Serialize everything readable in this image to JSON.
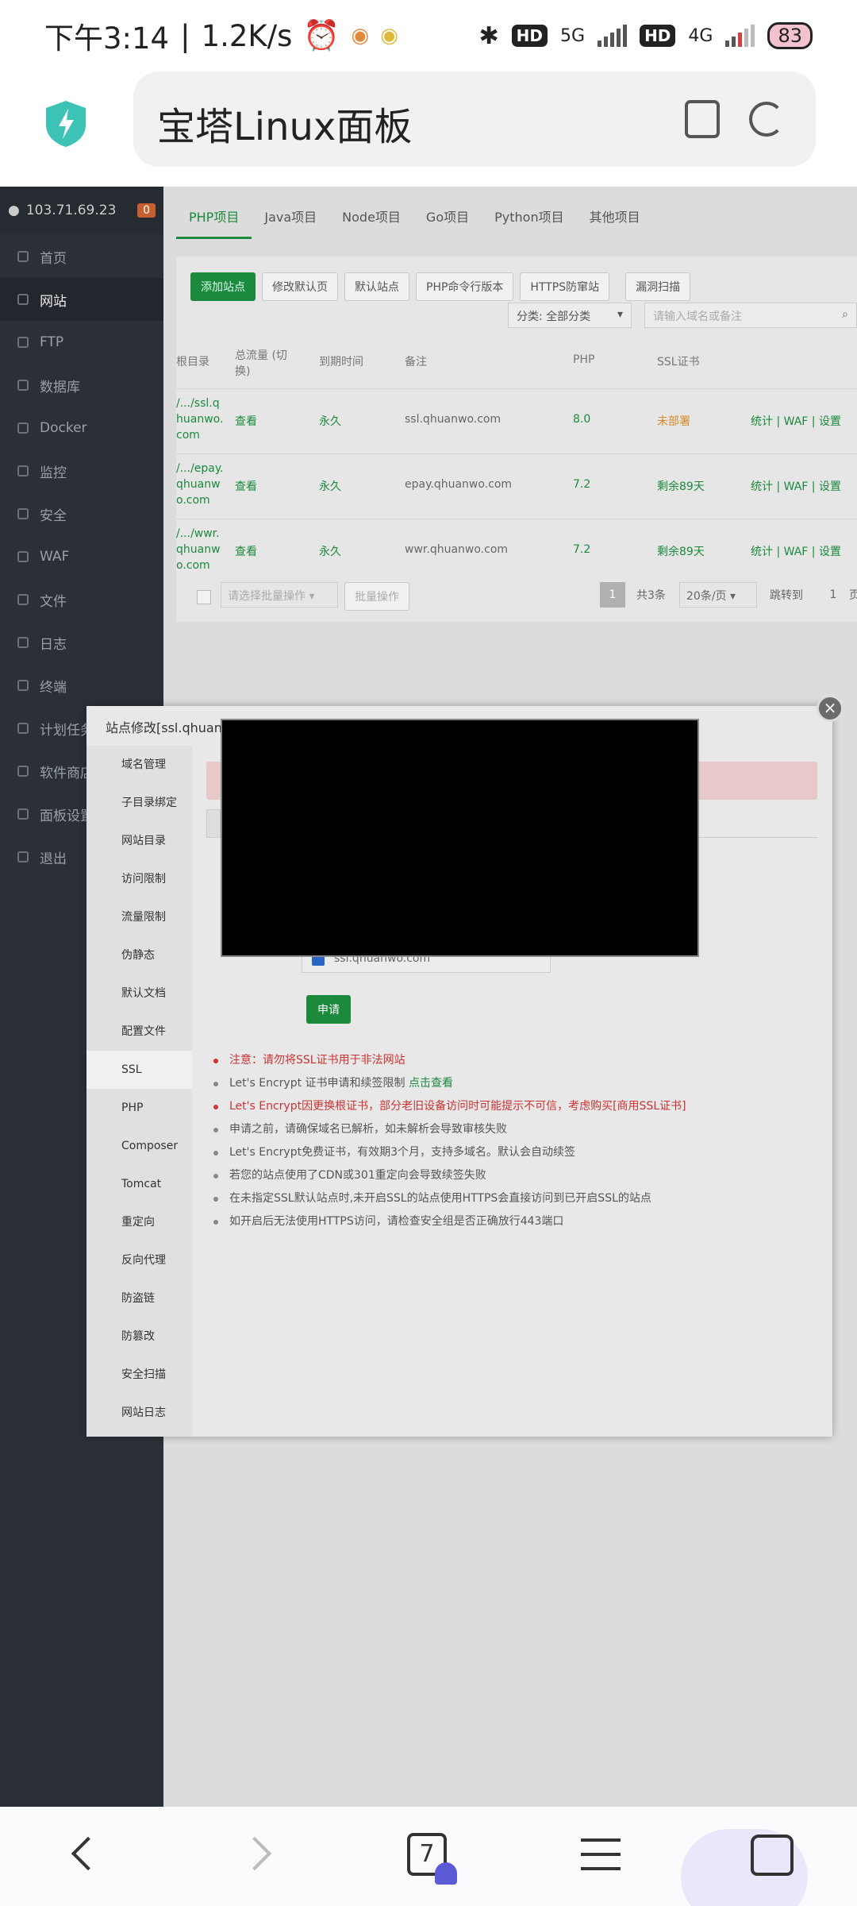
{
  "status_bar": {
    "time": "下午3:14",
    "speed": "1.2K/s",
    "hd1": "HD",
    "net1": "5G",
    "hd2": "HD",
    "net2": "4G",
    "battery": "83"
  },
  "browser": {
    "title": "宝塔Linux面板",
    "tab_count": "7"
  },
  "sidebar": {
    "ip": "103.71.69.23",
    "badge": "0",
    "items": [
      {
        "label": "首页"
      },
      {
        "label": "网站"
      },
      {
        "label": "FTP"
      },
      {
        "label": "数据库"
      },
      {
        "label": "Docker"
      },
      {
        "label": "监控"
      },
      {
        "label": "安全"
      },
      {
        "label": "WAF"
      },
      {
        "label": "文件"
      },
      {
        "label": "日志"
      },
      {
        "label": "终端"
      },
      {
        "label": "计划任务"
      },
      {
        "label": "软件商店"
      },
      {
        "label": "面板设置"
      },
      {
        "label": "退出"
      }
    ]
  },
  "tabs": [
    "PHP项目",
    "Java项目",
    "Node项目",
    "Go项目",
    "Python项目",
    "其他项目"
  ],
  "toolbar": {
    "add_site": "添加站点",
    "edit_default": "修改默认页",
    "default_site": "默认站点",
    "php_cli": "PHP命令行版本",
    "https_guard": "HTTPS防窜站",
    "vuln_scan": "漏洞扫描",
    "category": "分类: 全部分类",
    "search_placeholder": "请输入域名或备注"
  },
  "table": {
    "headers": [
      "根目录",
      "总流量 (切换)",
      "到期时间",
      "备注",
      "PHP",
      "SSL证书"
    ],
    "rows": [
      {
        "root": "/.../ssl.qhuanwo.com",
        "traffic": "查看",
        "expire": "永久",
        "note": "ssl.qhuanwo.com",
        "php": "8.0",
        "ssl": "未部署",
        "actions": "统计 | WAF | 设置"
      },
      {
        "root": "/.../epay.qhuanwo.com",
        "traffic": "查看",
        "expire": "永久",
        "note": "epay.qhuanwo.com",
        "php": "7.2",
        "ssl": "剩余89天",
        "actions": "统计 | WAF | 设置"
      },
      {
        "root": "/.../wwr.qhuanwo.com",
        "traffic": "查看",
        "expire": "永久",
        "note": "wwr.qhuanwo.com",
        "php": "7.2",
        "ssl": "剩余89天",
        "actions": "统计 | WAF | 设置"
      }
    ]
  },
  "pager": {
    "batch_placeholder": "请选择批量操作",
    "batch_button": "批量操作",
    "page": "1",
    "total": "共3条",
    "per_page": "20条/页",
    "jump": "跳转到",
    "jump_value": "1",
    "page_unit": "页"
  },
  "modal": {
    "title": "站点修改[ssl.qhuan",
    "close": "×",
    "menu": [
      "域名管理",
      "子目录绑定",
      "网站目录",
      "访问限制",
      "流量限制",
      "伪静态",
      "默认文档",
      "配置文件",
      "SSL",
      "PHP",
      "Composer",
      "Tomcat",
      "重定向",
      "反向代理",
      "防盗链",
      "防篡改",
      "安全扫描",
      "网站日志"
    ],
    "domain": "ssl.qhuanwo.com",
    "apply": "申请",
    "notes": [
      "注意：请勿将SSL证书用于非法网站",
      "Let's Encrypt 证书申请和续签限制",
      "Let's Encrypt因更换根证书，部分老旧设备访问时可能提示不可信，考虑购买[商用SSL证书]",
      "申请之前，请确保域名已解析，如未解析会导致审核失败",
      "Let's Encrypt免费证书，有效期3个月，支持多域名。默认会自动续签",
      "若您的站点使用了CDN或301重定向会导致续签失败",
      "在未指定SSL默认站点时,未开启SSL的站点使用HTTPS会直接访问到已开启SSL的站点",
      "如开启后无法使用HTTPS访问，请检查安全组是否正确放行443端口"
    ],
    "note_link": "点击查看"
  }
}
